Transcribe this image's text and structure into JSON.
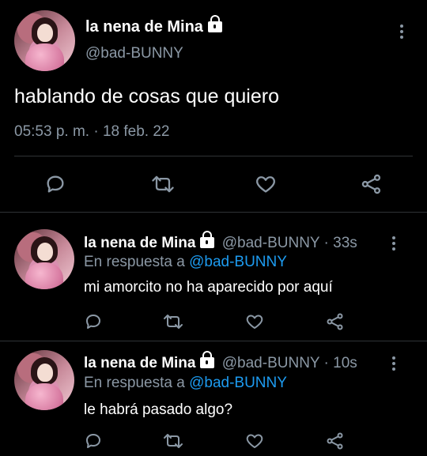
{
  "main_tweet": {
    "name": "la nena de Mina",
    "handle": "@bad-BUNNY",
    "text": "hablando de cosas que quiero",
    "timestamp": "05:53 p. m. · 18 feb. 22",
    "icons": [
      "reply-icon",
      "retweet-icon",
      "like-icon",
      "share-icon"
    ]
  },
  "replies": [
    {
      "name": "la nena de Mina",
      "meta": "@bad-BUNNY · 33s",
      "reply_prefix": "En respuesta a",
      "reply_to": "@bad-BUNNY",
      "text": "mi amorcito no ha aparecido por aquí"
    },
    {
      "name": "la nena de Mina",
      "meta": "@bad-BUNNY · 10s",
      "reply_prefix": "En respuesta a",
      "reply_to": "@bad-BUNNY",
      "text": "le habrá pasado algo?"
    }
  ],
  "colors": {
    "background": "#000000",
    "muted": "#8b98a5",
    "link": "#1d9bf0",
    "divider": "#2f3336"
  }
}
